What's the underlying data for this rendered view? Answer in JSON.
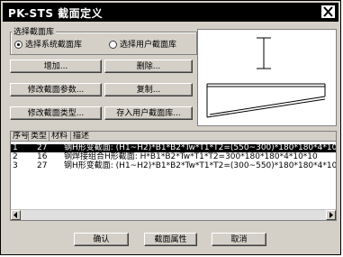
{
  "window": {
    "title": "PK-STS  截面定义"
  },
  "group": {
    "label": "选择截面库",
    "radio_system": {
      "label": "选择系统截面库",
      "checked": true
    },
    "radio_user": {
      "label": "选择用户截面库",
      "checked": false
    }
  },
  "buttons": {
    "add": "增加...",
    "delete": "删除...",
    "modify_params": "修改截面参数...",
    "copy": "复制...",
    "modify_type": "修改截面类型...",
    "save_to_user": "存入用户截面库...",
    "ok": "确认",
    "properties": "截面属性",
    "cancel": "取消"
  },
  "list": {
    "columns": [
      "序号",
      "类型",
      "材料",
      "描述"
    ],
    "rows": [
      {
        "index": "1",
        "type": "27",
        "material": "钢",
        "description": "H形变截面:  (H1~H2)*B1*B2*Tw*T1*T2=(550~300)*180*180*4*10",
        "selected": true
      },
      {
        "index": "2",
        "type": "16",
        "material": "钢",
        "description": "焊接组合H形截面:  H*B1*B2*Tw*T1*T2=300*180*180*4*10*10",
        "selected": false
      },
      {
        "index": "3",
        "type": "27",
        "material": "钢",
        "description": "H形变截面:  (H1~H2)*B1*B2*Tw*T1*T2=(300~550)*180*180*4*10",
        "selected": false
      }
    ]
  }
}
